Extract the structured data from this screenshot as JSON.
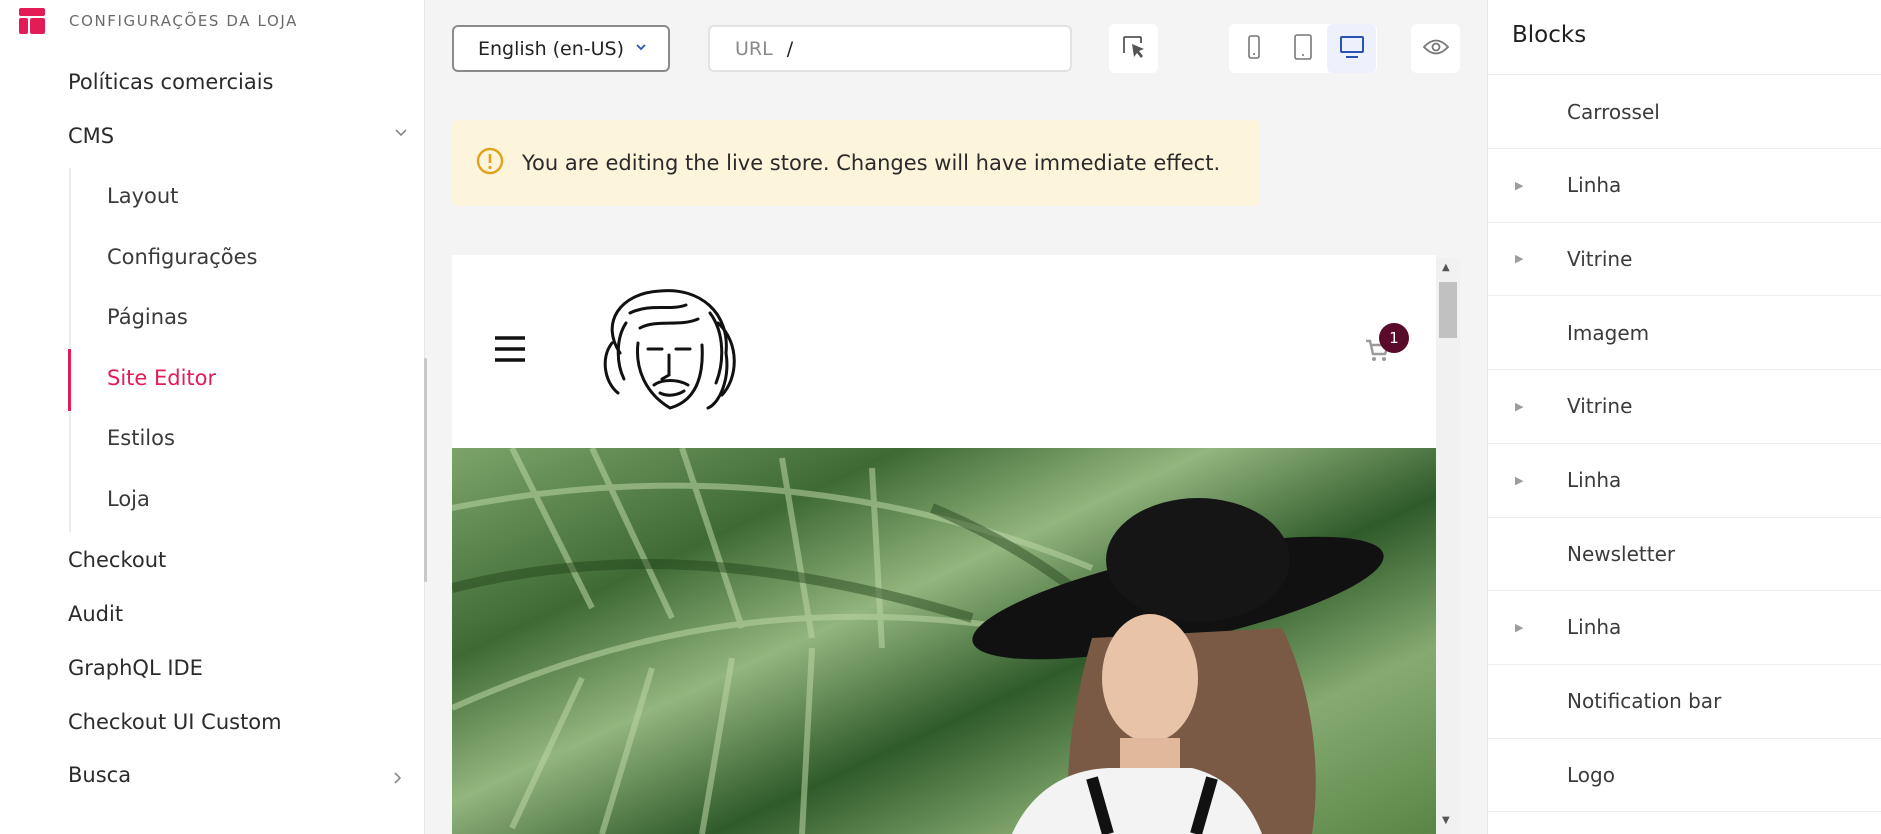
{
  "sidebar": {
    "section_title": "CONFIGURAÇÕES DA LOJA",
    "items": [
      {
        "label": "Políticas comerciais"
      },
      {
        "label": "CMS"
      },
      {
        "label": "Checkout"
      },
      {
        "label": "Audit"
      },
      {
        "label": "GraphQL IDE"
      },
      {
        "label": "Checkout UI Custom"
      },
      {
        "label": "Busca"
      }
    ],
    "cms_children": [
      {
        "label": "Layout"
      },
      {
        "label": "Configurações"
      },
      {
        "label": "Páginas"
      },
      {
        "label": "Site Editor",
        "active": true
      },
      {
        "label": "Estilos"
      },
      {
        "label": "Loja"
      }
    ]
  },
  "toolbar": {
    "locale": "English (en-US)",
    "url_label": "URL",
    "url_value": "/",
    "device_active": "desktop"
  },
  "banner": {
    "message": "You are editing the live store. Changes will have immediate effect."
  },
  "preview": {
    "cart_count": "1"
  },
  "blocks_panel": {
    "title": "Blocks",
    "items": [
      {
        "label": "Carrossel",
        "expandable": false
      },
      {
        "label": "Linha",
        "expandable": true
      },
      {
        "label": "Vitrine",
        "expandable": true
      },
      {
        "label": "Imagem",
        "expandable": false
      },
      {
        "label": "Vitrine",
        "expandable": true
      },
      {
        "label": "Linha",
        "expandable": true
      },
      {
        "label": "Newsletter",
        "expandable": false
      },
      {
        "label": "Linha",
        "expandable": true
      },
      {
        "label": "Notification bar",
        "expandable": false
      },
      {
        "label": "Logo",
        "expandable": false
      }
    ]
  },
  "colors": {
    "accent": "#e31c58",
    "link_blue": "#2953b2",
    "warning_bg": "#fdf4dc",
    "warning_icon": "#e0a21a",
    "cart_badge": "#5a0a2a"
  }
}
